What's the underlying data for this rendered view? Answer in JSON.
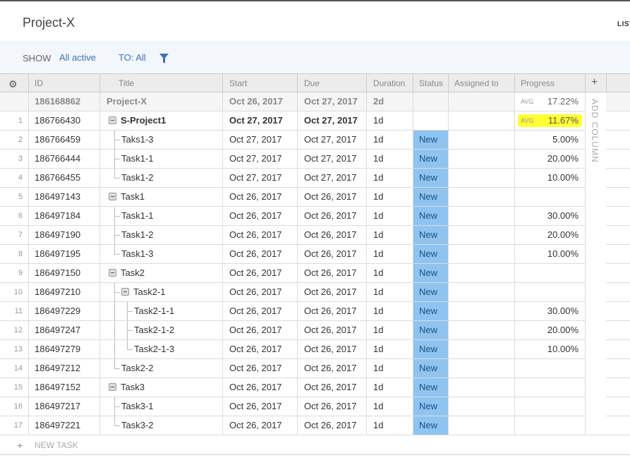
{
  "project": {
    "title": "Project-X",
    "list_tab": "LIST"
  },
  "filter": {
    "show_label": "SHOW",
    "show_value": "All active",
    "to_label": "TO: All"
  },
  "columns": {
    "id": "ID",
    "title": "Title",
    "start": "Start",
    "due": "Due",
    "duration": "Duration",
    "status": "Status",
    "assigned": "Assigned to",
    "progress": "Progress",
    "add": "+"
  },
  "summary": {
    "id": "186168862",
    "title": "Project-X",
    "start": "Oct 26, 2017",
    "due": "Oct 27, 2017",
    "duration": "2d",
    "avg_label": "AVG",
    "progress": "17.22%"
  },
  "rows": [
    {
      "num": "1",
      "id": "186766430",
      "title": "S-Project1",
      "start": "Oct 27, 2017",
      "due": "Oct 27, 2017",
      "duration": "1d",
      "status": "",
      "progress": "11.67%",
      "avg_label": "AVG"
    },
    {
      "num": "2",
      "id": "186766459",
      "title": "Taks1-3",
      "start": "Oct 27, 2017",
      "due": "Oct 27, 2017",
      "duration": "1d",
      "status": "New",
      "progress": "5.00%"
    },
    {
      "num": "3",
      "id": "186766444",
      "title": "Task1-1",
      "start": "Oct 27, 2017",
      "due": "Oct 27, 2017",
      "duration": "1d",
      "status": "New",
      "progress": "20.00%"
    },
    {
      "num": "4",
      "id": "186766455",
      "title": "Task1-2",
      "start": "Oct 27, 2017",
      "due": "Oct 27, 2017",
      "duration": "1d",
      "status": "New",
      "progress": "10.00%"
    },
    {
      "num": "5",
      "id": "186497143",
      "title": "Task1",
      "start": "Oct 26, 2017",
      "due": "Oct 26, 2017",
      "duration": "1d",
      "status": "New",
      "progress": ""
    },
    {
      "num": "6",
      "id": "186497184",
      "title": "Task1-1",
      "start": "Oct 26, 2017",
      "due": "Oct 26, 2017",
      "duration": "1d",
      "status": "New",
      "progress": "30.00%"
    },
    {
      "num": "7",
      "id": "186497190",
      "title": "Task1-2",
      "start": "Oct 26, 2017",
      "due": "Oct 26, 2017",
      "duration": "1d",
      "status": "New",
      "progress": "20.00%"
    },
    {
      "num": "8",
      "id": "186497195",
      "title": "Task1-3",
      "start": "Oct 26, 2017",
      "due": "Oct 26, 2017",
      "duration": "1d",
      "status": "New",
      "progress": "10.00%"
    },
    {
      "num": "9",
      "id": "186497150",
      "title": "Task2",
      "start": "Oct 26, 2017",
      "due": "Oct 26, 2017",
      "duration": "1d",
      "status": "New",
      "progress": ""
    },
    {
      "num": "10",
      "id": "186497210",
      "title": "Task2-1",
      "start": "Oct 26, 2017",
      "due": "Oct 26, 2017",
      "duration": "1d",
      "status": "New",
      "progress": ""
    },
    {
      "num": "11",
      "id": "186497229",
      "title": "Task2-1-1",
      "start": "Oct 26, 2017",
      "due": "Oct 26, 2017",
      "duration": "1d",
      "status": "New",
      "progress": "30.00%"
    },
    {
      "num": "12",
      "id": "186497247",
      "title": "Task2-1-2",
      "start": "Oct 26, 2017",
      "due": "Oct 26, 2017",
      "duration": "1d",
      "status": "New",
      "progress": "20.00%"
    },
    {
      "num": "13",
      "id": "186497279",
      "title": "Task2-1-3",
      "start": "Oct 26, 2017",
      "due": "Oct 26, 2017",
      "duration": "1d",
      "status": "New",
      "progress": "10.00%"
    },
    {
      "num": "14",
      "id": "186497212",
      "title": "Task2-2",
      "start": "Oct 26, 2017",
      "due": "Oct 26, 2017",
      "duration": "1d",
      "status": "New",
      "progress": ""
    },
    {
      "num": "15",
      "id": "186497152",
      "title": "Task3",
      "start": "Oct 26, 2017",
      "due": "Oct 26, 2017",
      "duration": "1d",
      "status": "New",
      "progress": ""
    },
    {
      "num": "16",
      "id": "186497217",
      "title": "Task3-1",
      "start": "Oct 26, 2017",
      "due": "Oct 26, 2017",
      "duration": "1d",
      "status": "New",
      "progress": ""
    },
    {
      "num": "17",
      "id": "186497221",
      "title": "Task3-2",
      "start": "Oct 26, 2017",
      "due": "Oct 26, 2017",
      "duration": "1d",
      "status": "New",
      "progress": ""
    }
  ],
  "add_column_label": "ADD COLUMN",
  "new_task_label": "NEW TASK",
  "colors": {
    "accent": "#3a74b5",
    "status_new": "#8fc4f2",
    "overdue": "#e05a4b",
    "highlight": "#ffff33"
  }
}
